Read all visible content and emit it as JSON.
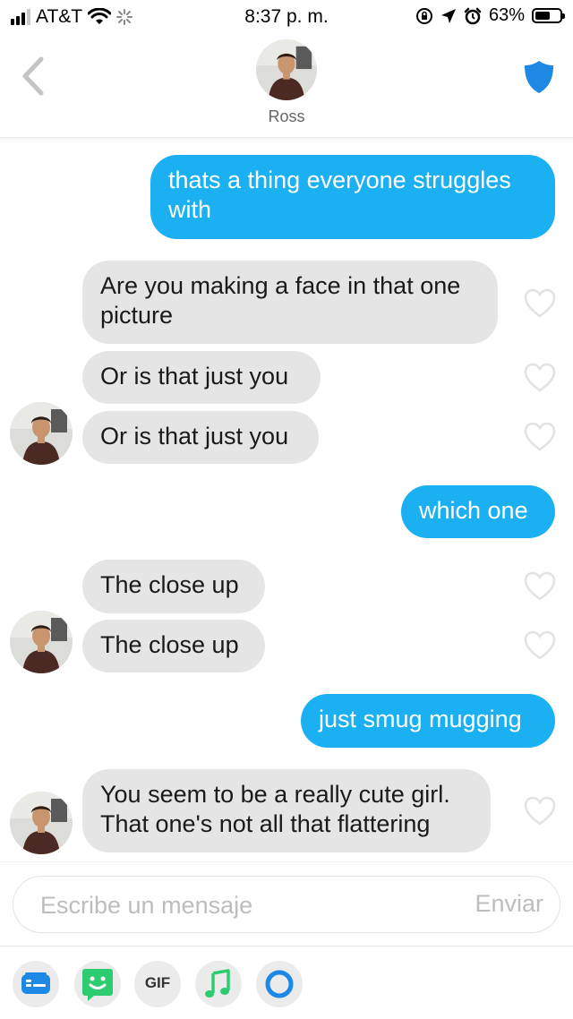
{
  "status_bar": {
    "carrier": "AT&T",
    "time": "8:37 p. m.",
    "battery_percent": "63%",
    "battery_level": 0.63
  },
  "header": {
    "contact_name": "Ross"
  },
  "messages": [
    {
      "from": "me",
      "text": "thats a thing everyone struggles with"
    },
    {
      "from": "them",
      "text": "Are you making a face in that one picture"
    },
    {
      "from": "them",
      "text": "Or is that just you"
    },
    {
      "from": "them",
      "text": "Or is that just you"
    },
    {
      "from": "me",
      "text": "which one"
    },
    {
      "from": "them",
      "text": "The close up"
    },
    {
      "from": "them",
      "text": "The close up"
    },
    {
      "from": "me",
      "text": "just smug mugging"
    },
    {
      "from": "them",
      "text": "You seem to be a really cute girl. That one's not all that flattering"
    }
  ],
  "composer": {
    "placeholder": "Escribe un mensaje",
    "send_label": "Enviar"
  },
  "toolbar": {
    "gif_label": "GIF",
    "icons": [
      "stickers-icon",
      "bitmoji-icon",
      "gif-icon",
      "music-icon",
      "loop-icon"
    ]
  },
  "colors": {
    "sent_bubble": "#1ab0f2",
    "received_bubble": "#e5e5e5",
    "shield": "#1e88e5",
    "music": "#2ecc71"
  }
}
